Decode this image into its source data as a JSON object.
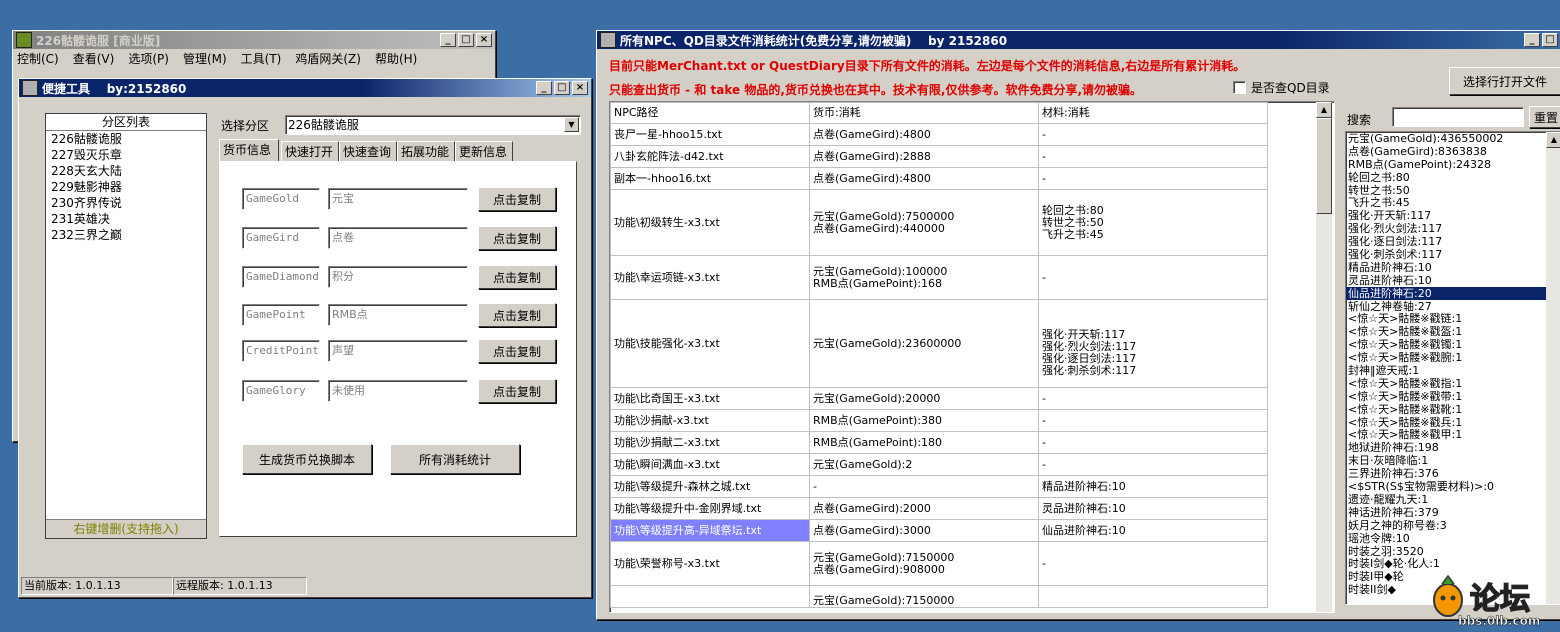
{
  "back_window": {
    "title": "226骷髅诡服 [商业版]",
    "menu": [
      "控制(C)",
      "查看(V)",
      "选项(P)",
      "管理(M)",
      "工具(T)",
      "鸡盾网关(Z)",
      "帮助(H)"
    ]
  },
  "tool_window": {
    "title": "便捷工具    by:2152860",
    "zone_list_header": "分区列表",
    "zones": [
      "226骷髅诡服",
      "227毁灭乐章",
      "228天玄大陆",
      "229魅影神器",
      "230齐界传说",
      "231英雄决",
      "232三界之巅"
    ],
    "zone_list_footer": "右键增删(支持拖入)",
    "select_zone_label": "选择分区",
    "select_zone_value": "226骷髅诡服",
    "tabs": [
      "货币信息",
      "快速打开",
      "快速查询",
      "拓展功能",
      "更新信息"
    ],
    "currency_rows": [
      {
        "code": "GameGold",
        "name": "元宝",
        "button": "点击复制"
      },
      {
        "code": "GameGird",
        "name": "点卷",
        "button": "点击复制"
      },
      {
        "code": "GameDiamond",
        "name": "积分",
        "button": "点击复制"
      },
      {
        "code": "GamePoint",
        "name": "RMB点",
        "button": "点击复制"
      },
      {
        "code": "CreditPoint",
        "name": "声望",
        "button": "点击复制"
      },
      {
        "code": "GameGlory",
        "name": "未使用",
        "button": "点击复制"
      }
    ],
    "gen_script_button": "生成货币兑换脚本",
    "all_stats_button": "所有消耗统计",
    "status_current": "当前版本: 1.0.1.13",
    "status_remote": "远程版本: 1.0.1.13"
  },
  "stats_window": {
    "title": "所有NPC、QD目录文件消耗统计(免费分享,请勿被骗)    by 2152860",
    "notice1": "目前只能MerChant.txt or QuestDiary目录下所有文件的消耗。左边是每个文件的消耗信息,右边是所有累计消耗。",
    "notice2": "只能查出货币 - 和 take 物品的,货币兑换也在其中。技术有限,仅供参考。软件免费分享,请勿被骗。",
    "qd_checkbox_label": "是否查QD目录",
    "select_file_button": "选择行打开文件",
    "search_label": "搜索",
    "reset_button": "重置",
    "columns": [
      "NPC路径",
      "货币:消耗",
      "材料:消耗"
    ],
    "rows": [
      {
        "path": "丧尸一星-hhoo15.txt",
        "money": "点卷(GameGird):4800",
        "material": "-"
      },
      {
        "path": "八卦玄舵阵法-d42.txt",
        "money": "点卷(GameGird):2888",
        "material": "-"
      },
      {
        "path": "副本一-hhoo16.txt",
        "money": "点卷(GameGird):4800",
        "material": "-"
      },
      {
        "path": "功能\\初级转生-x3.txt",
        "money": "元宝(GameGold):7500000\n点卷(GameGird):440000",
        "material": "轮回之书:80\n转世之书:50\n飞升之书:45"
      },
      {
        "path": "功能\\幸运项链-x3.txt",
        "money": "元宝(GameGold):100000\nRMB点(GamePoint):168",
        "material": "-"
      },
      {
        "path": "功能\\技能强化-x3.txt",
        "money": "元宝(GameGold):23600000",
        "material": "强化·开天斩:117\n强化·烈火剑法:117\n强化·逐日剑法:117\n强化·刺杀剑术:117"
      },
      {
        "path": "功能\\比奇国王-x3.txt",
        "money": "元宝(GameGold):20000",
        "material": "-"
      },
      {
        "path": "功能\\沙捐献-x3.txt",
        "money": "RMB点(GamePoint):380",
        "material": "-"
      },
      {
        "path": "功能\\沙捐献二-x3.txt",
        "money": "RMB点(GamePoint):180",
        "material": "-"
      },
      {
        "path": "功能\\瞬间满血-x3.txt",
        "money": "元宝(GameGold):2",
        "material": "-"
      },
      {
        "path": "功能\\等级提升-森林之城.txt",
        "money": "-",
        "material": "精品进阶神石:10"
      },
      {
        "path": "功能\\等级提升中-金刚界域.txt",
        "money": "点卷(GameGird):2000",
        "material": "灵品进阶神石:10"
      },
      {
        "path": "功能\\等级提升高-异域祭坛.txt",
        "money": "点卷(GameGird):3000",
        "material": "仙品进阶神石:10"
      },
      {
        "path": "功能\\荣誉称号-x3.txt",
        "money": "元宝(GameGold):7150000\n点卷(GameGird):908000",
        "material": "-"
      },
      {
        "path": "",
        "money": "元宝(GameGold):7150000",
        "material": ""
      }
    ],
    "totals": [
      "元宝(GameGold):436550002",
      "点卷(GameGird):8363838",
      "RMB点(GamePoint):24328",
      "轮回之书:80",
      "转世之书:50",
      "飞升之书:45",
      "强化·开天斩:117",
      "强化·烈火剑法:117",
      "强化·逐日剑法:117",
      "强化·刺杀剑术:117",
      "精品进阶神石:10",
      "灵品进阶神石:10",
      "仙品进阶神石:20",
      "斩仙之神卷轴:27",
      "<惊☆天>骷髅※戳链:1",
      "<惊☆天>骷髅※戳盔:1",
      "<惊☆天>骷髅※戳镯:1",
      "<惊☆天>骷髅※戳腕:1",
      "封神‖遮天戒:1",
      "<惊☆天>骷髅※戳指:1",
      "<惊☆天>骷髅※戳带:1",
      "<惊☆天>骷髅※戳靴:1",
      "<惊☆天>骷髅※戳兵:1",
      "<惊☆天>骷髅※戳甲:1",
      "地狱进阶神石:198",
      "末日·灰暗降临:1",
      "三界进阶神石:376",
      "<$STR(S$宝物需要材料)>:0",
      "遗迹·龍耀九天:1",
      "神话进阶神石:379",
      "妖月之神的称号卷:3",
      "瑶池令牌:10",
      "时装之羽:3520",
      "时装I剑◆轮·化人:1",
      "时装I甲◆轮",
      "时装II剑◆"
    ],
    "selected_total_index": 12
  },
  "watermark": {
    "text": "论坛",
    "site": "bbs.0lb.com"
  }
}
